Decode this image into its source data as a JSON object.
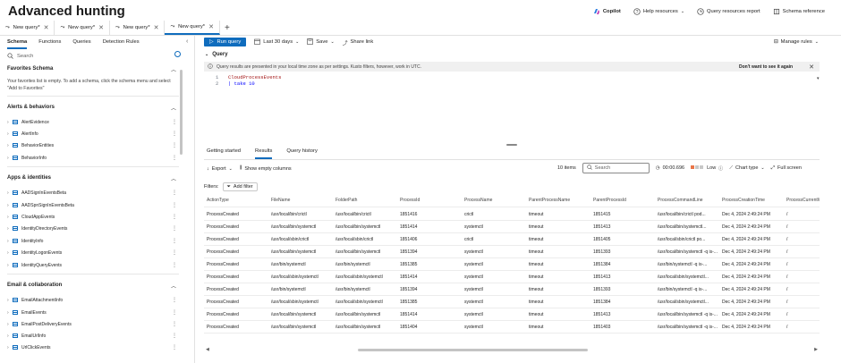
{
  "app": {
    "title": "Advanced hunting"
  },
  "topnav": [
    {
      "label": "Copilot",
      "icon": "copilot-icon"
    },
    {
      "label": "Help resources",
      "icon": "help-icon"
    },
    {
      "label": "Query resources report",
      "icon": "report-icon"
    },
    {
      "label": "Schema reference",
      "icon": "book-icon"
    }
  ],
  "query_tabs": [
    {
      "label": "New query*",
      "active": false
    },
    {
      "label": "New query*",
      "active": false
    },
    {
      "label": "New query*",
      "active": false
    },
    {
      "label": "New query*",
      "active": true
    }
  ],
  "sidebar": {
    "tabs": [
      "Schema",
      "Functions",
      "Queries",
      "Detection Rules"
    ],
    "search_placeholder": "Search",
    "favorites": {
      "title": "Favorites Schema",
      "text": "Your favorites list is empty. To add a schema, click the schema menu and select \"Add to Favorites\""
    },
    "sections": [
      {
        "title": "Alerts & behaviors",
        "items": [
          "AlertEvidence",
          "AlertInfo",
          "BehaviorEntities",
          "BehaviorInfo"
        ]
      },
      {
        "title": "Apps & identities",
        "items": [
          "AADSignInEventsBeta",
          "AADSpnSignInEventsBeta",
          "CloudAppEvents",
          "IdentityDirectoryEvents",
          "IdentityInfo",
          "IdentityLogonEvents",
          "IdentityQueryEvents"
        ]
      },
      {
        "title": "Email & collaboration",
        "items": [
          "EmailAttachmentInfo",
          "EmailEvents",
          "EmailPostDeliveryEvents",
          "EmailUrlInfo",
          "UrlClickEvents"
        ]
      }
    ]
  },
  "toolbar": {
    "run": "Run query",
    "timerange": "Last 30 days",
    "save": "Save",
    "share": "Share link",
    "manage": "Manage rules"
  },
  "query": {
    "header": "Query",
    "banner": "Query results are presented in your local time zone as per settings. Kusto filters, however, work in UTC.",
    "banner_dismiss": "Don't want to see it again",
    "lines": [
      {
        "num": "1",
        "text": "CloudProcessEvents"
      },
      {
        "num": "2",
        "text": "| take 10"
      }
    ]
  },
  "results": {
    "tabs": [
      "Getting started",
      "Results",
      "Query history"
    ],
    "export": "Export",
    "show_empty": "Show empty columns",
    "count": "10 items",
    "search_placeholder": "Search",
    "duration": "00:00.696",
    "usage": "Low",
    "chart_type": "Chart type",
    "fullscreen": "Full screen",
    "filters_label": "Filters:",
    "add_filter": "Add filter",
    "columns": [
      "ActionType",
      "FileName",
      "FolderPath",
      "ProcessId",
      "ProcessName",
      "ParentProcessName",
      "ParentProcessId",
      "ProcessCommandLine",
      "ProcessCreationTime",
      "ProcessCurrentW"
    ],
    "rows": [
      [
        "ProcessCreated",
        "/usr/local/bin/crictl",
        "/usr/local/bin/crictl",
        "1851416",
        "crictl",
        "timeout",
        "1851415",
        "/usr/local/bin/crictl pod...",
        "Dec 4, 2024 2:49:24 PM",
        "/"
      ],
      [
        "ProcessCreated",
        "/usr/local/bin/systemctl",
        "/usr/local/bin/systemctl",
        "1851414",
        "systemctl",
        "timeout",
        "1851413",
        "/usr/local/bin/systemctl...",
        "Dec 4, 2024 2:49:24 PM",
        "/"
      ],
      [
        "ProcessCreated",
        "/usr/local/sbin/crictl",
        "/usr/local/sbin/crictl",
        "1851406",
        "crictl",
        "timeout",
        "1851405",
        "/usr/local/sbin/crictl po...",
        "Dec 4, 2024 2:49:24 PM",
        "/"
      ],
      [
        "ProcessCreated",
        "/usr/local/bin/systemctl",
        "/usr/local/bin/systemctl",
        "1851394",
        "systemctl",
        "timeout",
        "1851393",
        "/usr/local/bin/systemctl -q is-...",
        "Dec 4, 2024 2:49:24 PM",
        "/"
      ],
      [
        "ProcessCreated",
        "/usr/bin/systemctl",
        "/usr/bin/systemctl",
        "1851385",
        "systemctl",
        "timeout",
        "1851384",
        "/usr/bin/systemctl -q is-...",
        "Dec 4, 2024 2:49:24 PM",
        "/"
      ],
      [
        "ProcessCreated",
        "/usr/local/sbin/systemctl",
        "/usr/local/sbin/systemctl",
        "1851414",
        "systemctl",
        "timeout",
        "1851413",
        "/usr/local/sbin/systemctl...",
        "Dec 4, 2024 2:49:24 PM",
        "/"
      ],
      [
        "ProcessCreated",
        "/usr/bin/systemctl",
        "/usr/bin/systemctl",
        "1851394",
        "systemctl",
        "timeout",
        "1851393",
        "/usr/bin/systemctl -q is-...",
        "Dec 4, 2024 2:49:24 PM",
        "/"
      ],
      [
        "ProcessCreated",
        "/usr/local/sbin/systemctl",
        "/usr/local/sbin/systemctl",
        "1851385",
        "systemctl",
        "timeout",
        "1851384",
        "/usr/local/sbin/systemctl...",
        "Dec 4, 2024 2:49:24 PM",
        "/"
      ],
      [
        "ProcessCreated",
        "/usr/local/bin/systemctl",
        "/usr/local/bin/systemctl",
        "1851414",
        "systemctl",
        "timeout",
        "1851413",
        "/usr/local/bin/systemctl -q is-...",
        "Dec 4, 2024 2:49:24 PM",
        "/"
      ],
      [
        "ProcessCreated",
        "/usr/local/bin/systemctl",
        "/usr/local/bin/systemctl",
        "1851404",
        "systemctl",
        "timeout",
        "1851403",
        "/usr/local/bin/systemctl -q is-...",
        "Dec 4, 2024 2:49:24 PM",
        "/"
      ]
    ]
  },
  "colors": {
    "accent": "#0f6cbd",
    "low_usage": "#e97548",
    "banner_bg": "#f0f0f0"
  }
}
